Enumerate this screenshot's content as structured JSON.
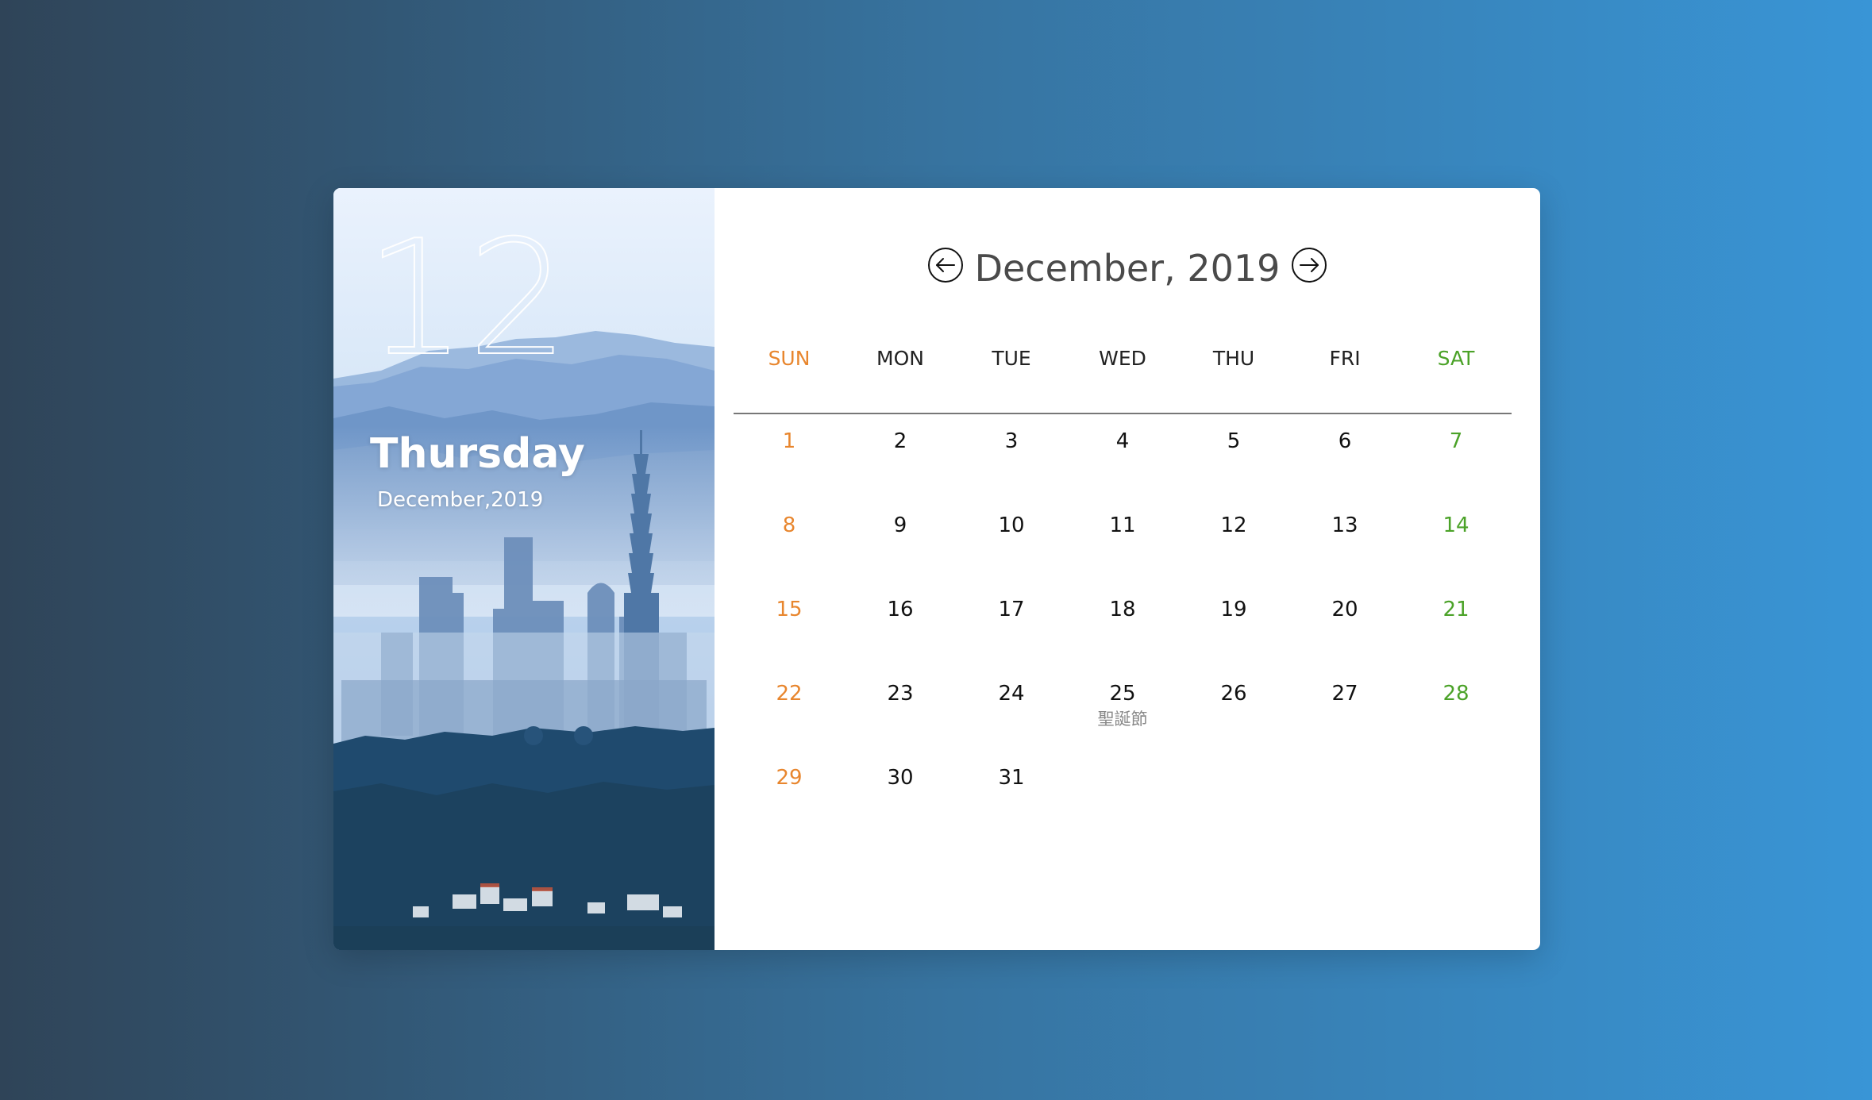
{
  "selected": {
    "day_number": "12",
    "weekday": "Thursday",
    "month_year": "December,2019"
  },
  "header": {
    "title": "December, 2019",
    "prev_icon": "arrow-left-circle-icon",
    "next_icon": "arrow-right-circle-icon"
  },
  "weekdays": [
    "SUN",
    "MON",
    "TUE",
    "WED",
    "THU",
    "FRI",
    "SAT"
  ],
  "weeks": [
    [
      {
        "day": "1"
      },
      {
        "day": "2"
      },
      {
        "day": "3"
      },
      {
        "day": "4"
      },
      {
        "day": "5"
      },
      {
        "day": "6"
      },
      {
        "day": "7"
      }
    ],
    [
      {
        "day": "8"
      },
      {
        "day": "9"
      },
      {
        "day": "10"
      },
      {
        "day": "11"
      },
      {
        "day": "12"
      },
      {
        "day": "13"
      },
      {
        "day": "14"
      }
    ],
    [
      {
        "day": "15"
      },
      {
        "day": "16"
      },
      {
        "day": "17"
      },
      {
        "day": "18"
      },
      {
        "day": "19"
      },
      {
        "day": "20"
      },
      {
        "day": "21"
      }
    ],
    [
      {
        "day": "22"
      },
      {
        "day": "23"
      },
      {
        "day": "24"
      },
      {
        "day": "25",
        "holiday": "聖誕節"
      },
      {
        "day": "26"
      },
      {
        "day": "27"
      },
      {
        "day": "28"
      }
    ],
    [
      {
        "day": "29"
      },
      {
        "day": "30"
      },
      {
        "day": "31"
      },
      {
        "day": ""
      },
      {
        "day": ""
      },
      {
        "day": ""
      },
      {
        "day": ""
      }
    ]
  ],
  "colors": {
    "sunday": "#e8862e",
    "saturday": "#4ba228",
    "weekday": "#111111",
    "holiday_label": "#888888"
  }
}
